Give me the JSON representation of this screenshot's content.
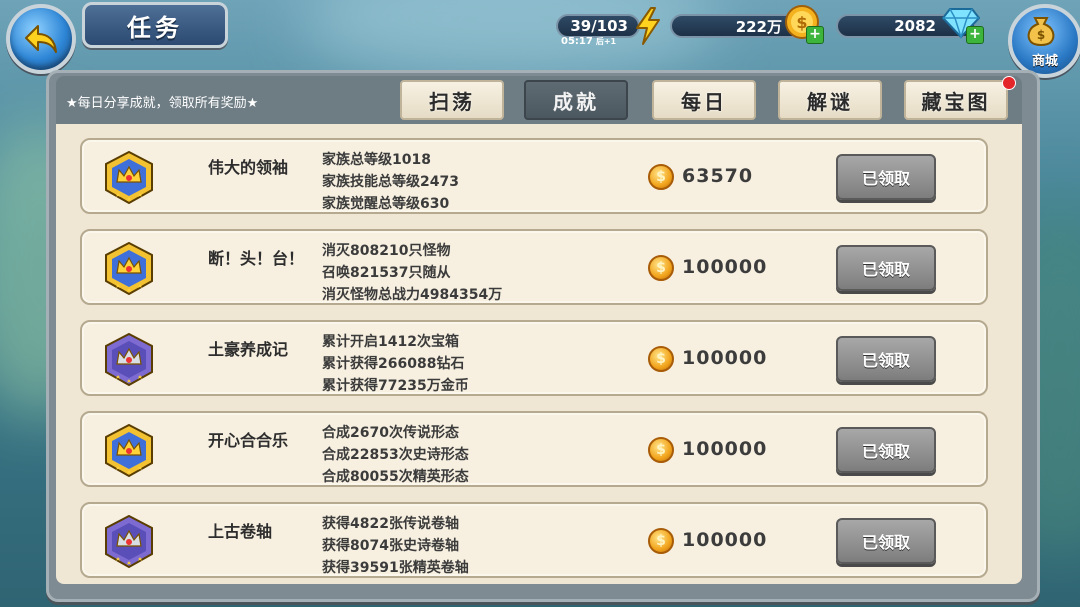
{
  "header": {
    "title": "任务"
  },
  "resources": {
    "energy": "39/103",
    "energy_timer": "05:17",
    "energy_timer_suffix": "后+1",
    "gold": "222万",
    "diamonds": "2082"
  },
  "shop_label": "商城",
  "share_note": "★每日分享成就，领取所有奖励★",
  "tabs": [
    {
      "label": "扫荡",
      "active": false
    },
    {
      "label": "成就",
      "active": true
    },
    {
      "label": "每日",
      "active": false
    },
    {
      "label": "解谜",
      "active": false
    },
    {
      "label": "藏宝图",
      "active": false
    }
  ],
  "achievements": [
    {
      "name": "伟大的领袖",
      "badge": "gold-crown-badge",
      "conditions": [
        "家族总等级1018",
        "家族技能总等级2473",
        "家族觉醒总等级630"
      ],
      "reward": "63570",
      "button": "已领取"
    },
    {
      "name": "断！头！台！",
      "badge": "gold-crown-badge",
      "conditions": [
        "消灭808210只怪物",
        "召唤821537只随从",
        "消灭怪物总战力4984354万"
      ],
      "reward": "100000",
      "button": "已领取"
    },
    {
      "name": "土豪养成记",
      "badge": "purple-silver-badge",
      "conditions": [
        "累计开启1412次宝箱",
        "累计获得266088钻石",
        "累计获得77235万金币"
      ],
      "reward": "100000",
      "button": "已领取"
    },
    {
      "name": "开心合合乐",
      "badge": "gold-crown-badge",
      "conditions": [
        "合成2670次传说形态",
        "合成22853次史诗形态",
        "合成80055次精英形态"
      ],
      "reward": "100000",
      "button": "已领取"
    },
    {
      "name": "上古卷轴",
      "badge": "purple-silver-badge",
      "conditions": [
        "获得4822张传说卷轴",
        "获得8074张史诗卷轴",
        "获得39591张精英卷轴"
      ],
      "reward": "100000",
      "button": "已领取"
    }
  ]
}
